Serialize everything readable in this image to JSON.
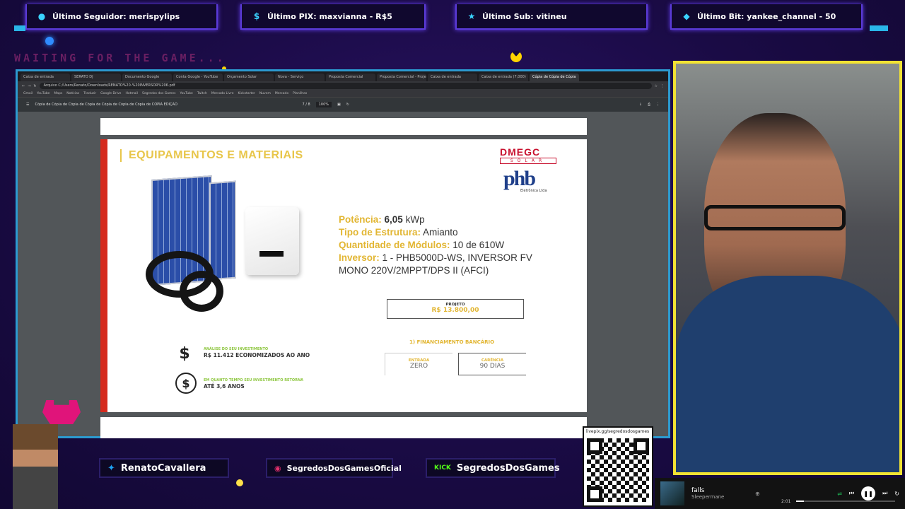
{
  "alerts": {
    "follower": "Último Seguidor: merispylips",
    "pix": "Último PIX: maxvianna - R$5",
    "sub": "Último Sub: vitineu",
    "bit": "Último Bit: yankee_channel - 50"
  },
  "waiting": "WAITING FOR THE GAME...",
  "browser": {
    "tabs": [
      "Caixa de entrada",
      "SERATO DJ",
      "Documento Google",
      "Conta Google - YouTube",
      "Orçamento Solar",
      "Nova - Serviço",
      "Proposta Comercial",
      "Proposta Comercial - Projeto",
      "Caixa de entrada",
      "Caixa de entrada (7,000)",
      "Cópia de Cópia de Cópia"
    ],
    "url": "Arquivo  C:/Users/Renato/Downloads/RENATO%20-%20INVERSOR%206.pdf",
    "bookmarks": [
      "Gmail",
      "YouTube",
      "Maps",
      "Notícias",
      "Traduzir",
      "Google Drive",
      "Hotmail",
      "Segredos dos Games",
      "YouTube",
      "Twitch",
      "Mercado Livre",
      "Kickstarter",
      "Nuvem",
      "Mercado",
      "Planilhas"
    ],
    "pdf_title": "Cópia de Cópia de Cópia de Cópia de Cópia de Cópia de Cópia de COPIA EDIÇÃO",
    "page_num": "7 / 8",
    "zoom": "100%"
  },
  "page": {
    "title": "EQUIPAMENTOS E MATERIAIS",
    "logo1_main": "DMEGC",
    "logo1_sub": "SOLAR",
    "logo2_mark": "phb",
    "logo2_sub": "Eletrônica Ltda",
    "potencia_label": "Potência:",
    "potencia_value": "6,05",
    "potencia_unit": "kWp",
    "estrutura_label": "Tipo de Estrutura:",
    "estrutura_value": "Amianto",
    "modulos_label": "Quantidade de Módulos:",
    "modulos_value": "10 de 610W",
    "inversor_label": "Inversor:",
    "inversor_value": "1 - PHB5000D-WS, INVERSOR FV",
    "inversor_value2": "MONO 220V/2MPPT/DPS II (AFCI)",
    "projeto_label": "PROJETO",
    "projeto_value": "R$ 13.800,00",
    "financ_label": "1) FINANCIAMENTO BANCÁRIO",
    "entrada_label": "ENTRADA",
    "entrada_value": "ZERO",
    "carencia_label": "CARÊNCIA",
    "carencia_value": "90 DIAS",
    "analise_label": "ANÁLISE DO SEU INVESTIMENTO",
    "analise_value": "R$ 11.412 ECONOMIZADOS AO ANO",
    "retorno_label": "EM QUANTO TEMPO SEU INVESTIMENTO RETORNA",
    "retorno_value": "ATÉ 3,6 ANOS"
  },
  "socials": {
    "twitter": "RenatoCavallera",
    "instagram": "SegredosDosGamesOficial",
    "kick_badge": "KICK",
    "kick": "SegredosDosGames"
  },
  "qr_label": "livepix.gg/segredosdosgames",
  "player": {
    "title": "falls",
    "artist": "Sleepermane",
    "time": "2:01"
  },
  "colors": {
    "accent_gold": "#e2b633",
    "frame_blue": "#2c9ad0",
    "cam_border": "#f2e233",
    "page_red": "#d52b1e"
  }
}
